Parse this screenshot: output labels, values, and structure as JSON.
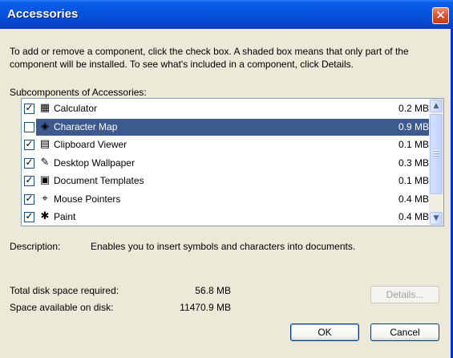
{
  "window": {
    "title": "Accessories",
    "close_glyph": "✕"
  },
  "instructions": "To add or remove a component, click the check box. A shaded box means that only part of the component will be installed. To see what's included in a component, click Details.",
  "subcomponents_label": "Subcomponents of Accessories:",
  "components": [
    {
      "name": "Calculator",
      "size": "0.2 MB",
      "checked": true,
      "selected": false,
      "icon": "calculator-icon",
      "glyph": "▦"
    },
    {
      "name": "Character Map",
      "size": "0.9 MB",
      "checked": false,
      "selected": true,
      "icon": "character-map-icon",
      "glyph": "◈"
    },
    {
      "name": "Clipboard Viewer",
      "size": "0.1 MB",
      "checked": true,
      "selected": false,
      "icon": "clipboard-icon",
      "glyph": "▤"
    },
    {
      "name": "Desktop Wallpaper",
      "size": "0.3 MB",
      "checked": true,
      "selected": false,
      "icon": "wallpaper-icon",
      "glyph": "✎"
    },
    {
      "name": "Document Templates",
      "size": "0.1 MB",
      "checked": true,
      "selected": false,
      "icon": "document-template-icon",
      "glyph": "▣"
    },
    {
      "name": "Mouse Pointers",
      "size": "0.4 MB",
      "checked": true,
      "selected": false,
      "icon": "mouse-pointer-icon",
      "glyph": "⌖"
    },
    {
      "name": "Paint",
      "size": "0.4 MB",
      "checked": true,
      "selected": false,
      "icon": "paint-icon",
      "glyph": "✱"
    }
  ],
  "description": {
    "label": "Description:",
    "value": "Enables you to insert symbols and characters into documents."
  },
  "disk": {
    "required_label": "Total disk space required:",
    "required_value": "56.8 MB",
    "available_label": "Space available on disk:",
    "available_value": "11470.9 MB"
  },
  "buttons": {
    "details": "Details...",
    "ok": "OK",
    "cancel": "Cancel"
  },
  "colors": {
    "titlebar": "#0553DE",
    "selection": "#3D5A8F",
    "dialog_bg": "#ECE9D8",
    "close_button": "#D8542F"
  }
}
